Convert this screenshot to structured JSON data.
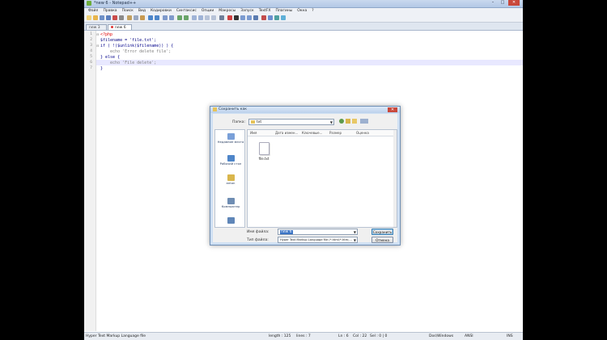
{
  "window": {
    "title": "*new 6 - Notepad++",
    "buttons": [
      "–",
      "□",
      "✕"
    ]
  },
  "menu": [
    "Файл",
    "Правка",
    "Поиск",
    "Вид",
    "Кодировки",
    "Синтаксис",
    "Опции",
    "Макросы",
    "Запуск",
    "TextFX",
    "Плагины",
    "Окна",
    "?"
  ],
  "tabs": [
    {
      "label": "new 3"
    },
    {
      "label": "new 6"
    }
  ],
  "code_lines": [
    {
      "num": "1",
      "text": "<?php"
    },
    {
      "num": "2",
      "text": "$filename = 'file.txt';"
    },
    {
      "num": "3",
      "text": "if ( !($unlink($filename)) ) {"
    },
    {
      "num": "4",
      "text": "    echo 'Error delete file';"
    },
    {
      "num": "5",
      "text": "} else {"
    },
    {
      "num": "6",
      "text": "    echo 'File delete';"
    },
    {
      "num": "7",
      "text": "}"
    }
  ],
  "status": {
    "file_type": "Hyper Text Markup Language file",
    "length": "length : 125",
    "lines": "lines : 7",
    "ln": "Ln : 6",
    "col": "Col : 22",
    "sel": "Sel : 0 | 0",
    "eol": "Dos\\Windows",
    "encoding": "ANSI",
    "mode": "INS"
  },
  "dialog": {
    "title": "Сохранить как",
    "folder_label": "Папка:",
    "folder_value": "txt",
    "places": [
      {
        "label": "Недавние места",
        "icon": "recent-places-icon",
        "color": "#7aa0d8"
      },
      {
        "label": "Рабочий стол",
        "icon": "desktop-icon",
        "color": "#4f86c9"
      },
      {
        "label": "anton",
        "icon": "user-folder-icon",
        "color": "#d9b64c"
      },
      {
        "label": "Компьютер",
        "icon": "computer-icon",
        "color": "#6f8db3"
      },
      {
        "label": "",
        "icon": "network-icon",
        "color": "#5f86b8"
      }
    ],
    "columns": [
      "Имя",
      "Дата измен...",
      "Ключевые...",
      "Размер",
      "Оценка"
    ],
    "files": [
      {
        "name": "file.txt"
      }
    ],
    "filename_label": "Имя файла:",
    "filename_value": "new 6",
    "filetype_label": "Тип файла:",
    "filetype_value": "Hyper Text Markup Language file (*.html;*.htm;...",
    "save_button": "Сохранить",
    "cancel_button": "Отмена"
  }
}
